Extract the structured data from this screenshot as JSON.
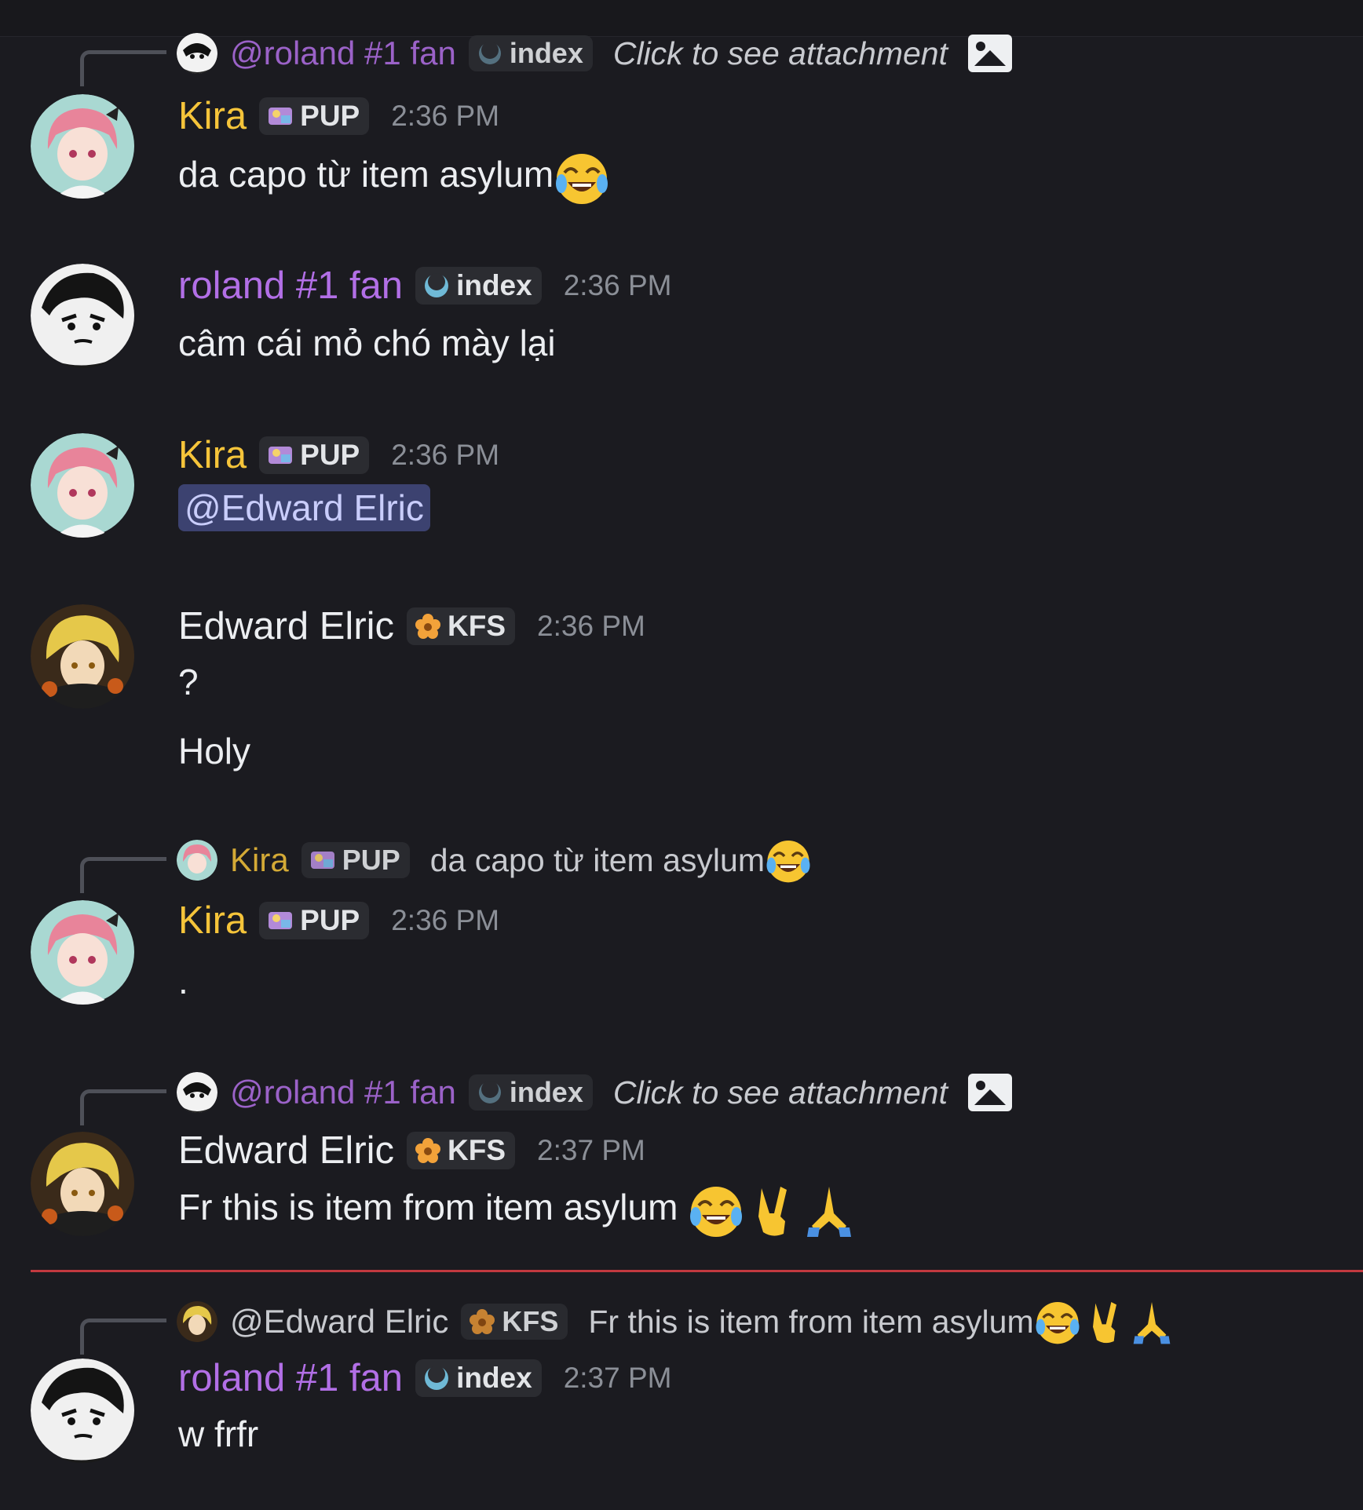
{
  "colors": {
    "background": "#1b1b20",
    "kira_name": "#f5c43a",
    "roland_name": "#b26fe6",
    "edward_name": "#eceef1",
    "mention_bg": "#3c4270",
    "new_messages_line": "#c2393f"
  },
  "messages": [
    {
      "reply": {
        "author": "@roland #1 fan",
        "tag": "index",
        "text": "Click to see attachment"
      },
      "author": "Kira",
      "tag": "PUP",
      "time": "2:36 PM",
      "lines": [
        "da capo từ item asylum"
      ],
      "emoji": [
        "joy-emoji"
      ]
    },
    {
      "author": "roland #1 fan",
      "tag": "index",
      "time": "2:36 PM",
      "lines": [
        "câm cái mỏ chó mày lại"
      ]
    },
    {
      "author": "Kira",
      "tag": "PUP",
      "time": "2:36 PM",
      "mention": "@Edward Elric"
    },
    {
      "author": "Edward Elric",
      "tag": "KFS",
      "time": "2:36 PM",
      "lines": [
        "?",
        "Holy"
      ]
    },
    {
      "reply": {
        "author": "Kira",
        "tag": "PUP",
        "text": "da capo từ item asylum"
      },
      "author": "Kira",
      "tag": "PUP",
      "time": "2:36 PM",
      "lines": [
        "."
      ]
    },
    {
      "reply": {
        "author": "@roland #1 fan",
        "tag": "index",
        "text": "Click to see attachment"
      },
      "author": "Edward Elric",
      "tag": "KFS",
      "time": "2:37 PM",
      "lines": [
        "Fr this is item from item asylum"
      ],
      "emoji": [
        "joy-emoji",
        "victory-hand-emoji",
        "folded-hands-emoji"
      ]
    },
    {
      "reply": {
        "author": "@Edward Elric",
        "tag": "KFS",
        "text": "Fr this is item from item asylum"
      },
      "author": "roland #1 fan",
      "tag": "index",
      "time": "2:37 PM",
      "lines": [
        "w frfr"
      ]
    }
  ]
}
